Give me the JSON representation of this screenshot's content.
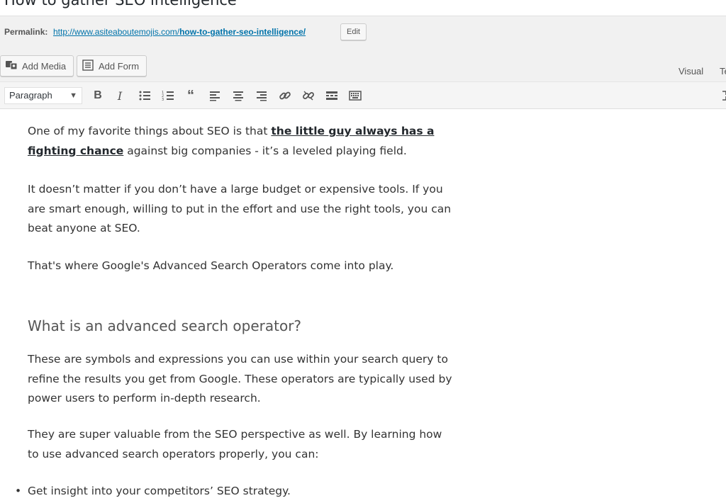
{
  "post": {
    "title": "How to gather SEO intelligence"
  },
  "permalink": {
    "label": "Permalink:",
    "url_base": "http://www.asiteaboutemojis.com/",
    "url_slug": "how-to-gather-seo-intelligence/",
    "edit_label": "Edit"
  },
  "media_bar": {
    "add_media": "Add Media",
    "add_form": "Add Form"
  },
  "editor_tabs": {
    "visual": "Visual",
    "text": "Te"
  },
  "toolbar": {
    "format_value": "Paragraph",
    "buttons": [
      "bold-icon",
      "italic-icon",
      "bullet-list-icon",
      "numbered-list-icon",
      "blockquote-icon",
      "align-left-icon",
      "align-center-icon",
      "align-right-icon",
      "link-icon",
      "unlink-icon",
      "read-more-icon",
      "toolbar-toggle-icon"
    ]
  },
  "content": {
    "p1_a": "One of my favorite things about SEO is that ",
    "p1_link": "the little guy always has a fighting chance",
    "p1_b": " against big companies - it’s a leveled playing field.",
    "p2": "It doesn’t matter if you don’t have a large budget or expensive tools. If you are smart enough, willing to put in the effort and use the right tools, you can beat anyone at SEO.",
    "p3": "That's where Google's Advanced Search Operators come into play.",
    "heading": "What is an advanced search operator?",
    "p4": "These are symbols and expressions you can use within your search query to refine the results you get from Google. These operators are typically used by power users to perform in-depth research.",
    "p5": "They are super valuable from the SEO perspective as well. By learning how to use advanced search operators properly, you can:",
    "list": [
      "Get insight into your competitors’ SEO strategy."
    ]
  },
  "colors": {
    "link": "#0073aa",
    "toolbar_bg": "#f5f5f5",
    "chrome_bg": "#f1f1f1"
  }
}
